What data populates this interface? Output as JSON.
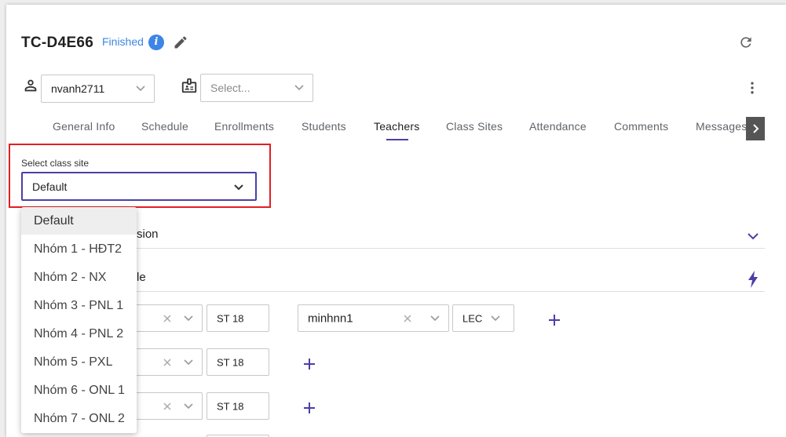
{
  "header": {
    "code": "TC-D4E66",
    "status": "Finished",
    "info_glyph": "i"
  },
  "filters": {
    "user_value": "nvanh2711",
    "secondary_placeholder": "Select..."
  },
  "tabs": [
    {
      "label": "General Info"
    },
    {
      "label": "Schedule"
    },
    {
      "label": "Enrollments"
    },
    {
      "label": "Students"
    },
    {
      "label": "Teachers"
    },
    {
      "label": "Class Sites"
    },
    {
      "label": "Attendance"
    },
    {
      "label": "Comments"
    },
    {
      "label": "Messages"
    }
  ],
  "active_tab": "Teachers",
  "class_site": {
    "label": "Select class site",
    "value": "Default",
    "options": [
      "Default",
      "Nhóm 1 - HĐT2",
      "Nhóm 2 - NX",
      "Nhóm 3 - PNL 1",
      "Nhóm 4 - PNL 2",
      "Nhóm 5 - PXL",
      "Nhóm 6 - ONL 1",
      "Nhóm 7 - ONL 2"
    ]
  },
  "sections": {
    "session_partial": "sion",
    "schedule_partial": "le"
  },
  "rows": [
    {
      "st_value": "ST 18",
      "teacher": "minhnn1",
      "role": "LEC"
    },
    {
      "st_value": "ST 18"
    },
    {
      "st_value": "ST 18"
    }
  ],
  "colors": {
    "accent": "#4b3fa6",
    "status": "#3d85e6",
    "highlight_border": "#e31e24"
  }
}
